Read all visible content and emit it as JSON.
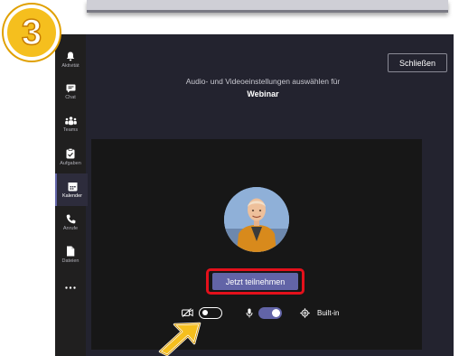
{
  "step_badge": {
    "number": "3"
  },
  "sidebar": {
    "items": [
      {
        "label": "Aktivität",
        "icon": "bell-icon",
        "active": false
      },
      {
        "label": "Chat",
        "icon": "chat-icon",
        "active": false
      },
      {
        "label": "Teams",
        "icon": "teams-icon",
        "active": false
      },
      {
        "label": "Aufgaben",
        "icon": "tasks-icon",
        "active": false
      },
      {
        "label": "Kalender",
        "icon": "calendar-icon",
        "active": true
      },
      {
        "label": "Anrufe",
        "icon": "phone-icon",
        "active": false
      },
      {
        "label": "Dateien",
        "icon": "file-icon",
        "active": false
      },
      {
        "label": "",
        "icon": "more-icon",
        "active": false
      }
    ]
  },
  "header": {
    "close_label": "Schließen",
    "subtitle": "Audio- und Videoeinstellungen auswählen für",
    "meeting_title": "Webinar"
  },
  "preview": {
    "join_label": "Jetzt teilnehmen",
    "device_label": "Built-in",
    "camera_on": false,
    "mic_on": true
  },
  "colors": {
    "accent": "#6264a7",
    "highlight_red": "#e4101b",
    "badge_yellow": "#f5bf1e",
    "app_background": "#23232f"
  }
}
